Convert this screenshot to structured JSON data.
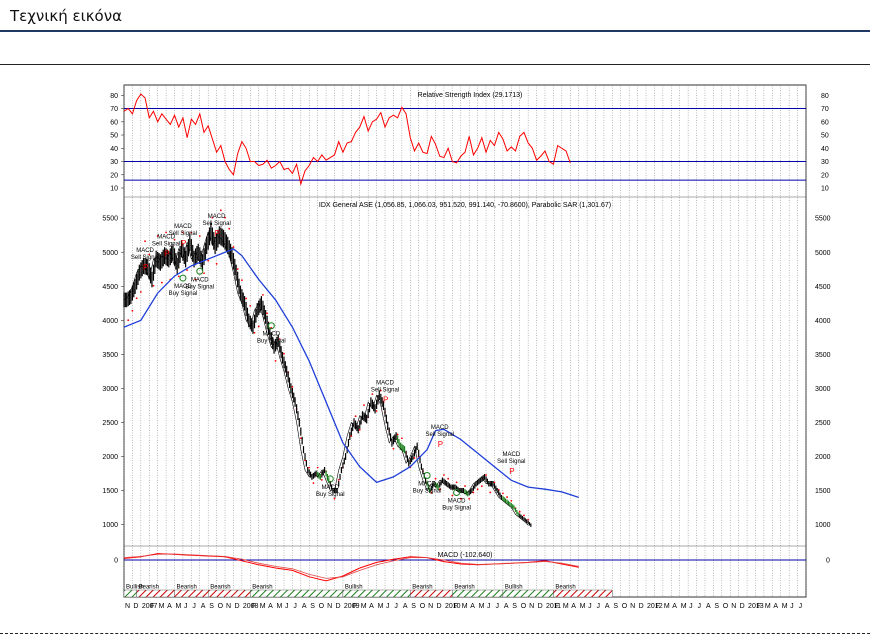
{
  "page": {
    "title": "Τεχνική εικόνα"
  },
  "chart_data": {
    "type": "line",
    "x_months": [
      "N",
      "D",
      "2007",
      "F",
      "M",
      "A",
      "M",
      "J",
      "J",
      "A",
      "S",
      "O",
      "N",
      "D",
      "2008",
      "F",
      "M",
      "A",
      "M",
      "J",
      "J",
      "A",
      "S",
      "O",
      "N",
      "D",
      "2009",
      "F",
      "M",
      "A",
      "M",
      "J",
      "J",
      "A",
      "S",
      "O",
      "N",
      "D",
      "2010",
      "F",
      "M",
      "A",
      "M",
      "J",
      "J",
      "A",
      "S",
      "O",
      "N",
      "D",
      "2011",
      "F",
      "M",
      "A",
      "M",
      "J",
      "J",
      "A",
      "S",
      "O",
      "N",
      "D",
      "2012",
      "F",
      "M",
      "A",
      "M",
      "J",
      "J",
      "A",
      "S",
      "O",
      "N",
      "D",
      "2013",
      "F",
      "M",
      "A",
      "M",
      "J",
      "J"
    ],
    "phases": [
      {
        "label": "Bullish",
        "type": "bull",
        "start": 0,
        "end": 1.5
      },
      {
        "label": "Bearish",
        "type": "bear",
        "start": 1.5,
        "end": 6
      },
      {
        "label": "Bearish",
        "type": "bear",
        "start": 6,
        "end": 10
      },
      {
        "label": "Bearish",
        "type": "bear",
        "start": 10,
        "end": 15
      },
      {
        "label": "Bearish",
        "type": "bull",
        "start": 15,
        "end": 26
      },
      {
        "label": "Bullish",
        "type": "bull",
        "start": 26,
        "end": 34
      },
      {
        "label": "Bearish",
        "type": "bear",
        "start": 34,
        "end": 39
      },
      {
        "label": "Bearish",
        "type": "bull",
        "start": 39,
        "end": 45
      },
      {
        "label": "Bullish",
        "type": "bull",
        "start": 45,
        "end": 51
      },
      {
        "label": "Bearish",
        "type": "bear",
        "start": 51,
        "end": 58
      }
    ],
    "rsi": {
      "title": "Relative Strength Index (29.1713)",
      "ticks": [
        10,
        20,
        30,
        40,
        50,
        60,
        70,
        80
      ],
      "levels": [
        70,
        30,
        16
      ],
      "ylim": [
        7,
        84
      ],
      "points": [
        [
          0,
          68
        ],
        [
          0.5,
          70
        ],
        [
          1,
          66
        ],
        [
          1.5,
          76
        ],
        [
          2,
          81
        ],
        [
          2.5,
          78
        ],
        [
          3,
          63
        ],
        [
          3.5,
          68
        ],
        [
          4,
          60
        ],
        [
          4.5,
          66
        ],
        [
          5,
          62
        ],
        [
          5.5,
          58
        ],
        [
          6,
          65
        ],
        [
          6.5,
          56
        ],
        [
          7,
          63
        ],
        [
          7.5,
          48
        ],
        [
          8,
          62
        ],
        [
          8.5,
          58
        ],
        [
          9,
          66
        ],
        [
          9.5,
          52
        ],
        [
          10,
          57
        ],
        [
          10.5,
          47
        ],
        [
          11,
          37
        ],
        [
          11.5,
          42
        ],
        [
          12,
          30
        ],
        [
          12.5,
          24
        ],
        [
          13,
          20
        ],
        [
          13.5,
          36
        ],
        [
          14,
          45
        ],
        [
          14.5,
          40
        ],
        [
          15,
          30
        ],
        [
          15.5,
          30
        ],
        [
          16,
          27
        ],
        [
          16.5,
          28
        ],
        [
          17,
          31
        ],
        [
          17.5,
          25
        ],
        [
          18,
          27
        ],
        [
          18.5,
          30
        ],
        [
          19,
          24
        ],
        [
          19.5,
          25
        ],
        [
          20,
          21
        ],
        [
          20.5,
          28
        ],
        [
          21,
          13
        ],
        [
          21.5,
          23
        ],
        [
          22,
          27
        ],
        [
          22.5,
          33
        ],
        [
          23,
          30
        ],
        [
          23.5,
          35
        ],
        [
          24,
          31
        ],
        [
          24.5,
          33
        ],
        [
          25,
          35
        ],
        [
          25.5,
          45
        ],
        [
          26,
          37
        ],
        [
          26.5,
          44
        ],
        [
          27,
          45
        ],
        [
          27.5,
          52
        ],
        [
          28,
          56
        ],
        [
          28.5,
          64
        ],
        [
          29,
          53
        ],
        [
          29.5,
          60
        ],
        [
          30,
          62
        ],
        [
          30.5,
          67
        ],
        [
          31,
          56
        ],
        [
          31.5,
          63
        ],
        [
          32,
          65
        ],
        [
          32.5,
          63
        ],
        [
          33,
          71
        ],
        [
          33.5,
          66
        ],
        [
          34,
          48
        ],
        [
          34.5,
          38
        ],
        [
          35,
          44
        ],
        [
          35.5,
          37
        ],
        [
          36,
          36
        ],
        [
          36.5,
          49
        ],
        [
          37,
          43
        ],
        [
          37.5,
          34
        ],
        [
          38,
          33
        ],
        [
          38.5,
          40
        ],
        [
          39,
          30
        ],
        [
          39.5,
          29
        ],
        [
          40,
          34
        ],
        [
          40.5,
          37
        ],
        [
          41,
          49
        ],
        [
          41.5,
          35
        ],
        [
          42,
          40
        ],
        [
          42.5,
          48
        ],
        [
          43,
          37
        ],
        [
          43.5,
          46
        ],
        [
          44,
          42
        ],
        [
          44.5,
          52
        ],
        [
          45,
          47
        ],
        [
          45.5,
          38
        ],
        [
          46,
          41
        ],
        [
          46.5,
          38
        ],
        [
          47,
          49
        ],
        [
          47.5,
          52
        ],
        [
          48,
          44
        ],
        [
          48.5,
          40
        ],
        [
          49,
          31
        ],
        [
          49.5,
          34
        ],
        [
          50,
          38
        ],
        [
          50.5,
          30
        ],
        [
          51,
          28
        ],
        [
          51.5,
          42
        ],
        [
          52,
          40
        ],
        [
          52.5,
          38
        ],
        [
          53,
          29
        ]
      ]
    },
    "price": {
      "title": "IDX General ASE (1,056.85, 1,066.03, 951.520, 991.140, -70.8600), Parabolic SAR (1,301.67)",
      "ticks": [
        1000,
        1500,
        2000,
        2500,
        3000,
        3500,
        4000,
        4500,
        5000,
        5500
      ],
      "ylim": [
        700,
        5650
      ],
      "close": [
        [
          0,
          4300
        ],
        [
          0.5,
          4350
        ],
        [
          1,
          4500
        ],
        [
          1.5,
          4700
        ],
        [
          2,
          4800
        ],
        [
          2.5,
          4780
        ],
        [
          3,
          4600
        ],
        [
          3.5,
          4900
        ],
        [
          4,
          4850
        ],
        [
          4.5,
          4950
        ],
        [
          5,
          4900
        ],
        [
          5.5,
          5000
        ],
        [
          6,
          4800
        ],
        [
          6.5,
          5050
        ],
        [
          7,
          4900
        ],
        [
          7.5,
          5150
        ],
        [
          8,
          4900
        ],
        [
          8.5,
          5000
        ],
        [
          9,
          4850
        ],
        [
          9.5,
          5100
        ],
        [
          10,
          5300
        ],
        [
          10.5,
          5100
        ],
        [
          11,
          5250
        ],
        [
          11.5,
          5200
        ],
        [
          12,
          5100
        ],
        [
          12.5,
          4950
        ],
        [
          13,
          4700
        ],
        [
          13.5,
          4400
        ],
        [
          14,
          4250
        ],
        [
          14.5,
          4000
        ],
        [
          15,
          3900
        ],
        [
          15.5,
          4150
        ],
        [
          16,
          4250
        ],
        [
          16.5,
          4050
        ],
        [
          17,
          3800
        ],
        [
          17.5,
          3600
        ],
        [
          18,
          3700
        ],
        [
          18.5,
          3450
        ],
        [
          19,
          3250
        ],
        [
          19.5,
          3000
        ],
        [
          20,
          2800
        ],
        [
          20.5,
          2500
        ],
        [
          21,
          2100
        ],
        [
          21.5,
          1800
        ],
        [
          22,
          1700
        ],
        [
          22.5,
          1750
        ],
        [
          23,
          1700
        ],
        [
          23.5,
          1800
        ],
        [
          24,
          1650
        ],
        [
          24.5,
          1500
        ],
        [
          25,
          1500
        ],
        [
          25.5,
          1800
        ],
        [
          26,
          2000
        ],
        [
          26.5,
          2300
        ],
        [
          27,
          2500
        ],
        [
          27.5,
          2400
        ],
        [
          28,
          2600
        ],
        [
          28.5,
          2550
        ],
        [
          29,
          2800
        ],
        [
          29.5,
          2700
        ],
        [
          30,
          2900
        ],
        [
          30.5,
          2750
        ],
        [
          31,
          2450
        ],
        [
          31.5,
          2200
        ],
        [
          32,
          2300
        ],
        [
          32.5,
          2150
        ],
        [
          33,
          2100
        ],
        [
          33.5,
          1900
        ],
        [
          34,
          2000
        ],
        [
          34.5,
          2150
        ],
        [
          35,
          1850
        ],
        [
          35.5,
          1650
        ],
        [
          36,
          1500
        ],
        [
          36.5,
          1600
        ],
        [
          37,
          1550
        ],
        [
          37.5,
          1650
        ],
        [
          38,
          1600
        ],
        [
          38.5,
          1550
        ],
        [
          39,
          1550
        ],
        [
          39.5,
          1500
        ],
        [
          40,
          1500
        ],
        [
          40.5,
          1450
        ],
        [
          41,
          1500
        ],
        [
          41.5,
          1600
        ],
        [
          42,
          1650
        ],
        [
          42.5,
          1700
        ],
        [
          43,
          1600
        ],
        [
          43.5,
          1600
        ],
        [
          44,
          1500
        ],
        [
          44.5,
          1400
        ],
        [
          45,
          1350
        ],
        [
          45.5,
          1300
        ],
        [
          46,
          1250
        ],
        [
          46.5,
          1150
        ],
        [
          47,
          1100
        ],
        [
          47.5,
          1050
        ],
        [
          48,
          991
        ]
      ],
      "ma": [
        [
          0,
          3900
        ],
        [
          2,
          4000
        ],
        [
          4,
          4400
        ],
        [
          6,
          4650
        ],
        [
          8,
          4800
        ],
        [
          10,
          4900
        ],
        [
          12,
          5000
        ],
        [
          13,
          5050
        ],
        [
          14,
          4950
        ],
        [
          16,
          4600
        ],
        [
          18,
          4300
        ],
        [
          20,
          3900
        ],
        [
          22,
          3400
        ],
        [
          24,
          2800
        ],
        [
          26,
          2200
        ],
        [
          28,
          1850
        ],
        [
          30,
          1620
        ],
        [
          32,
          1700
        ],
        [
          34,
          1850
        ],
        [
          36,
          2100
        ],
        [
          37,
          2380
        ],
        [
          38,
          2400
        ],
        [
          40,
          2250
        ],
        [
          42,
          2050
        ],
        [
          44,
          1850
        ],
        [
          46,
          1650
        ],
        [
          48,
          1550
        ],
        [
          50,
          1520
        ],
        [
          52,
          1480
        ],
        [
          54,
          1400
        ]
      ],
      "signals": [
        {
          "kind": "sell",
          "t": 2.5,
          "v": 4800
        },
        {
          "kind": "sell",
          "t": 5,
          "v": 5000
        },
        {
          "kind": "sell",
          "t": 7,
          "v": 5150
        },
        {
          "kind": "sell",
          "t": 11,
          "v": 5300
        },
        {
          "kind": "buy",
          "t": 7,
          "v": 4650
        },
        {
          "kind": "buy",
          "t": 9,
          "v": 4750
        },
        {
          "kind": "buy",
          "t": 17.5,
          "v": 3950
        },
        {
          "kind": "buy",
          "t": 24.5,
          "v": 1700
        },
        {
          "kind": "sell",
          "t": 31,
          "v": 2850
        },
        {
          "kind": "sell",
          "t": 37.5,
          "v": 2200
        },
        {
          "kind": "buy",
          "t": 36,
          "v": 1750
        },
        {
          "kind": "buy",
          "t": 39.5,
          "v": 1500
        },
        {
          "kind": "sell",
          "t": 46,
          "v": 1800
        }
      ],
      "signal_labels": {
        "sell": [
          "MACD",
          "Sell Signal"
        ],
        "buy": [
          "MACD",
          "Buy Signal"
        ]
      }
    },
    "macd": {
      "title": "MACD (-102.640)",
      "ticks": [
        0
      ],
      "ylim": [
        -400,
        150
      ],
      "macd_line": [
        [
          0,
          20
        ],
        [
          2,
          40
        ],
        [
          4,
          80
        ],
        [
          6,
          70
        ],
        [
          8,
          60
        ],
        [
          10,
          50
        ],
        [
          12,
          40
        ],
        [
          14,
          -10
        ],
        [
          16,
          -60
        ],
        [
          18,
          -100
        ],
        [
          20,
          -130
        ],
        [
          22,
          -210
        ],
        [
          24,
          -260
        ],
        [
          26,
          -200
        ],
        [
          28,
          -100
        ],
        [
          30,
          -30
        ],
        [
          32,
          10
        ],
        [
          34,
          40
        ],
        [
          36,
          30
        ],
        [
          38,
          -20
        ],
        [
          40,
          -50
        ],
        [
          42,
          -60
        ],
        [
          44,
          -50
        ],
        [
          46,
          -40
        ],
        [
          48,
          -30
        ],
        [
          50,
          -10
        ],
        [
          52,
          -50
        ],
        [
          54,
          -90
        ]
      ],
      "signal_line": [
        [
          0,
          30
        ],
        [
          2,
          45
        ],
        [
          4,
          70
        ],
        [
          6,
          75
        ],
        [
          8,
          65
        ],
        [
          10,
          55
        ],
        [
          12,
          45
        ],
        [
          14,
          10
        ],
        [
          16,
          -40
        ],
        [
          18,
          -80
        ],
        [
          20,
          -110
        ],
        [
          22,
          -180
        ],
        [
          24,
          -230
        ],
        [
          26,
          -210
        ],
        [
          28,
          -130
        ],
        [
          30,
          -60
        ],
        [
          32,
          -10
        ],
        [
          34,
          30
        ],
        [
          36,
          30
        ],
        [
          38,
          0
        ],
        [
          40,
          -40
        ],
        [
          42,
          -55
        ],
        [
          44,
          -52
        ],
        [
          46,
          -42
        ],
        [
          48,
          -32
        ],
        [
          50,
          -18
        ],
        [
          52,
          -40
        ],
        [
          54,
          -80
        ]
      ]
    },
    "colors": {
      "rsi": "#ff0000",
      "levels": "#0000aa",
      "ma": "#1f3fd8",
      "sar": "#ff0000",
      "bull": "#1a7f1a",
      "bear": "#cc0000",
      "grid": "#7a7a7a"
    }
  }
}
